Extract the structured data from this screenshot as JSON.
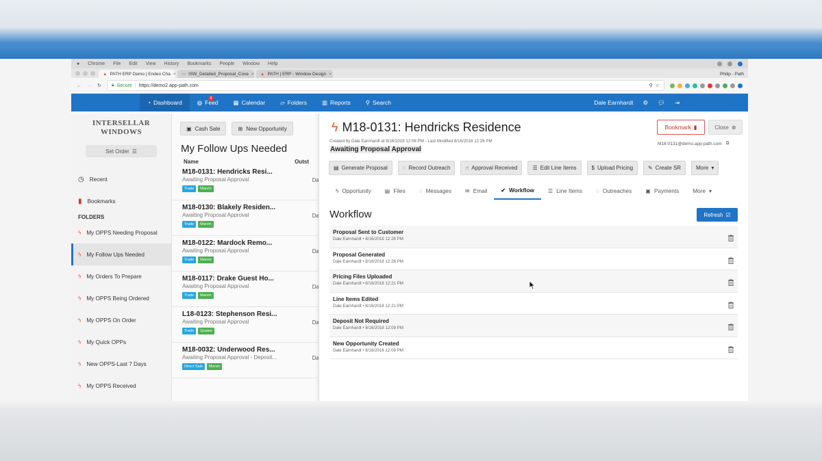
{
  "os_menu": {
    "items": [
      "Chrome",
      "File",
      "Edit",
      "View",
      "History",
      "Bookmarks",
      "People",
      "Window",
      "Help"
    ]
  },
  "browser": {
    "tabs": [
      {
        "label": "PATH ERP Demo | Endeo Cha"
      },
      {
        "label": "ISW_Detailed_Proposal_Cove"
      },
      {
        "label": "PATH | ERP - Window Design"
      }
    ],
    "profile": "Philip - Path",
    "secure_label": "Secure",
    "url": "https://demo2.app-path.com"
  },
  "nav": {
    "dashboard": "Dashboard",
    "feed": "Feed",
    "feed_badge": "3",
    "calendar": "Calendar",
    "folders": "Folders",
    "reports": "Reports",
    "search": "Search",
    "user": "Dale Earnhardt"
  },
  "sidebar": {
    "logo_line1": "INTERSELLAR",
    "logo_line2": "WINDOWS",
    "set_order": "Set Order",
    "recent": "Recent",
    "bookmarks": "Bookmarks",
    "folders_heading": "FOLDERS",
    "folders": [
      {
        "label": "My OPPS Needing Proposal"
      },
      {
        "label": "My Follow Ups Needed"
      },
      {
        "label": "My Orders To Prepare"
      },
      {
        "label": "My OPPS Being Ordered"
      },
      {
        "label": "My OPPS On Order"
      },
      {
        "label": "My Quick OPPs"
      },
      {
        "label": "New OPPS-Last 7 Days"
      },
      {
        "label": "My OPPS Received"
      }
    ]
  },
  "list": {
    "cash_sale": "Cash Sale",
    "new_opportunity": "New Opportunity",
    "title": "My Follow Ups Needed",
    "col_name": "Name",
    "col_outstanding": "Outst",
    "items": [
      {
        "title": "M18-0131: Hendricks Resi...",
        "status": "Awaiting Proposal Approval",
        "tag1": "Trade",
        "tag2": "Marvin",
        "date": "Da"
      },
      {
        "title": "M18-0130: Blakely Residen...",
        "status": "Awaiting Proposal Approval",
        "tag1": "Trade",
        "tag2": "Marvin",
        "date": "Da"
      },
      {
        "title": "M18-0122: Mardock Remo...",
        "status": "Awaiting Proposal Approval",
        "tag1": "Trade",
        "tag2": "Marvin",
        "date": "Da"
      },
      {
        "title": "M18-0117: Drake Guest Ho...",
        "status": "Awaiting Proposal Approval",
        "tag1": "Trade",
        "tag2": "Marvin",
        "date": "Da"
      },
      {
        "title": "L18-0123: Stephenson Resi...",
        "status": "Awaiting Proposal Approval",
        "tag1": "Trade",
        "tag2": "Quaker",
        "date": "Da"
      },
      {
        "title": "M18-0032: Underwood Res...",
        "status": "Awaiting Proposal Approval - Deposit...",
        "tag1": "Direct Sale",
        "tag2": "Marvin",
        "date": "Da"
      }
    ]
  },
  "detail": {
    "title": "M18-0131: Hendricks Residence",
    "meta": "Created by Dale Earnhardt at 8/16/2018 12:06 PM - Last Modified 8/16/2018 12:26 PM",
    "status": "Awaiting Proposal Approval",
    "bookmark": "Bookmark",
    "close": "Close",
    "email": "M18-0131@demo.app-path.com",
    "actions": [
      "Generate Proposal",
      "Record Outreach",
      "Approval Received",
      "Edit Line Items",
      "Upload Pricing",
      "Create SR",
      "More"
    ],
    "tabs": [
      "Opportunity",
      "Files",
      "Messages",
      "Email",
      "Workflow",
      "Line Items",
      "Outreaches",
      "Payments",
      "More"
    ],
    "workflow_title": "Workflow",
    "refresh": "Refresh",
    "workflow": [
      {
        "name": "Proposal Sent to Customer",
        "meta": "Dale Earnhardt • 8/16/2018 12:26 PM"
      },
      {
        "name": "Proposal Generated",
        "meta": "Dale Earnhardt • 8/16/2018 12:26 PM"
      },
      {
        "name": "Pricing Files Uploaded",
        "meta": "Dale Earnhardt • 8/16/2018 12:21 PM"
      },
      {
        "name": "Line Items Edited",
        "meta": "Dale Earnhardt • 8/16/2018 12:21 PM"
      },
      {
        "name": "Deposit Not Required",
        "meta": "Dale Earnhardt • 8/16/2018 12:09 PM"
      },
      {
        "name": "New Opportunity Created",
        "meta": "Dale Earnhardt • 8/16/2018 12:09 PM"
      }
    ]
  },
  "colors": {
    "brand": "#1f74c5",
    "trade_tag": "#29a6e0",
    "vendor_tag": "#4caf50",
    "flame": "#e8542c",
    "bookmark_red": "#d9534f"
  }
}
